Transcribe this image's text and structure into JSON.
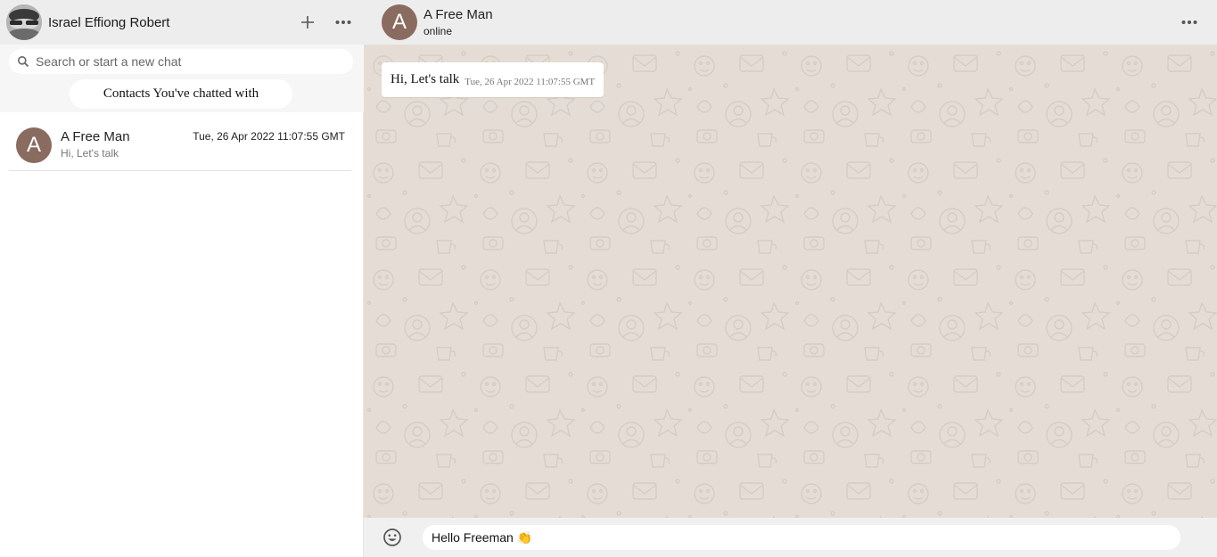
{
  "sidebar": {
    "user_name": "Israel Effiong Robert",
    "new_chat_icon": "plus-icon",
    "menu_icon": "more-horizontal-icon",
    "search_placeholder": "Search or start a new chat",
    "contacts_heading": "Contacts You've chatted with",
    "chats": [
      {
        "avatar_letter": "A",
        "name": "A Free Man",
        "preview": "Hi, Let's talk",
        "time": "Tue, 26 Apr 2022 11:07:55 GMT"
      }
    ]
  },
  "chat": {
    "contact_avatar_letter": "A",
    "contact_name": "A Free Man",
    "contact_status": "online",
    "menu_icon": "more-horizontal-icon",
    "messages": [
      {
        "text": "Hi, Let's talk",
        "time": "Tue, 26 Apr 2022 11:07:55 GMT"
      }
    ],
    "composer": {
      "emoji_icon": "smiley-icon",
      "draft_value": "Hello Freeman 👏"
    }
  },
  "colors": {
    "header_bg": "#ededed",
    "wallpaper_bg": "#e5ddd5",
    "avatar_bg": "#8a6b60",
    "bubble_bg": "#ffffff"
  }
}
